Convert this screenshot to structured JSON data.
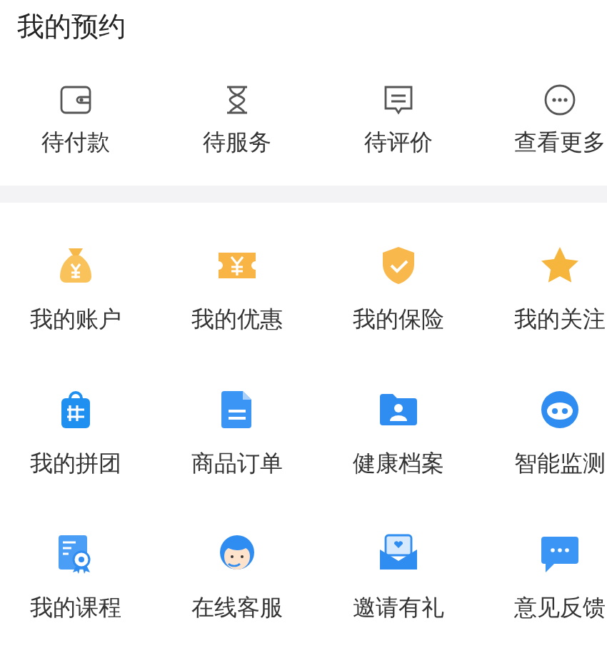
{
  "title": "我的预约",
  "order_actions": [
    {
      "label": "待付款",
      "kind": "wallet"
    },
    {
      "label": "待服务",
      "kind": "hourglass"
    },
    {
      "label": "待评价",
      "kind": "comment"
    },
    {
      "label": "查看更多",
      "kind": "more"
    }
  ],
  "services": [
    {
      "label": "我的账户",
      "kind": "moneybag"
    },
    {
      "label": "我的优惠",
      "kind": "coupon"
    },
    {
      "label": "我的保险",
      "kind": "shield"
    },
    {
      "label": "我的关注",
      "kind": "star"
    },
    {
      "label": "我的拼团",
      "kind": "bag"
    },
    {
      "label": "商品订单",
      "kind": "document"
    },
    {
      "label": "健康档案",
      "kind": "folder"
    },
    {
      "label": "智能监测",
      "kind": "robot"
    },
    {
      "label": "我的课程",
      "kind": "certificate"
    },
    {
      "label": "在线客服",
      "kind": "agent"
    },
    {
      "label": "邀请有礼",
      "kind": "envelope"
    },
    {
      "label": "意见反馈",
      "kind": "chat"
    }
  ]
}
